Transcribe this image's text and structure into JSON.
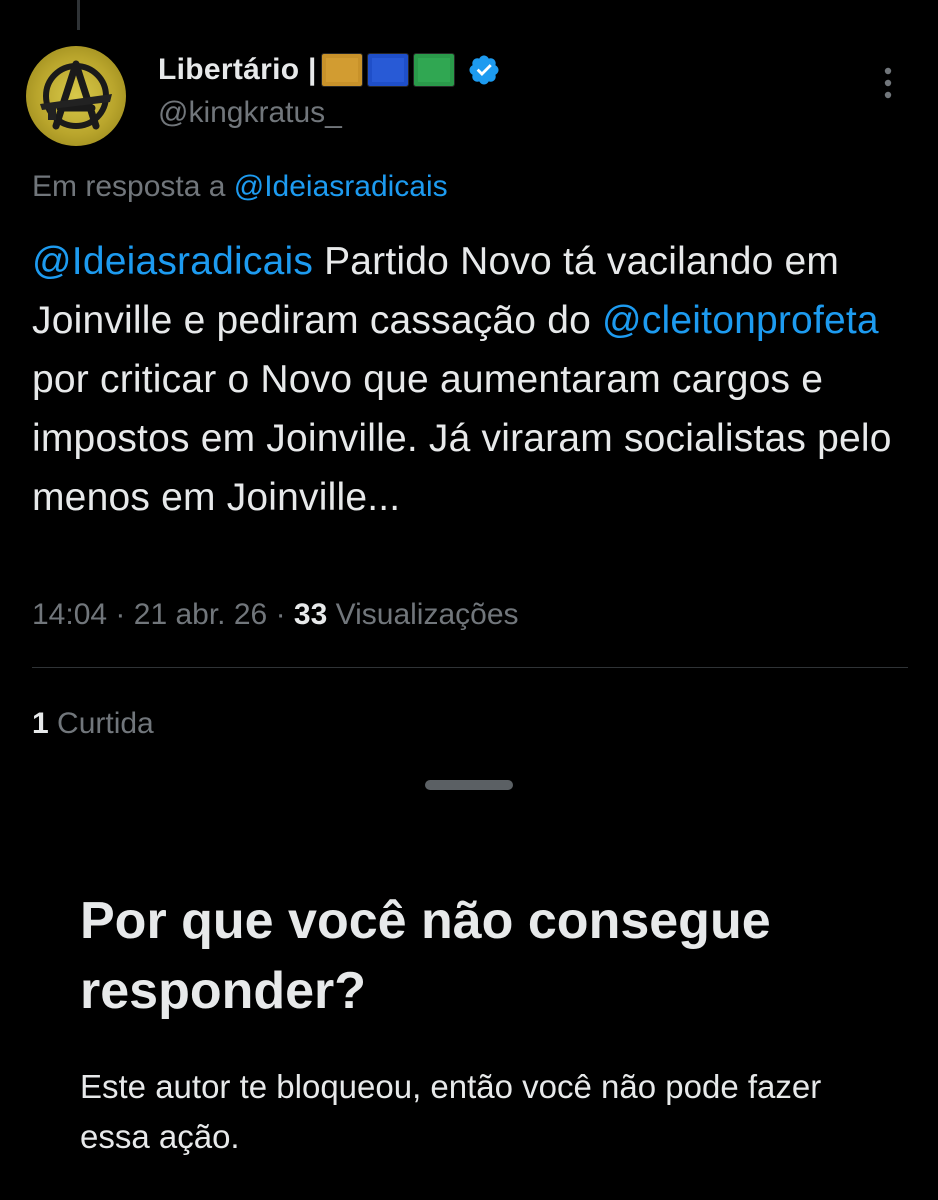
{
  "tweet": {
    "author": {
      "display_name": "Libertário |",
      "handle": "@kingkratus_",
      "verified": true,
      "flag_colors": [
        "#c8922a",
        "#1f4fc9",
        "#2a9a4a"
      ]
    },
    "reply_to_label": "Em resposta a",
    "reply_to_handle": "@Ideiasradicais",
    "text": {
      "mention1": "@Ideiasradicais",
      "part1": " Partido Novo tá vacilando em Joinville e pediram cassação do ",
      "mention2": "@cleitonprofeta",
      "part2": " por criticar o Novo que aumentaram cargos e impostos em Joinville. Já viraram socialistas pelo menos em Joinville..."
    },
    "time": "14:04",
    "date": "21 abr. 26",
    "views_count": "33",
    "views_label": "Visualizações",
    "separator": "·",
    "likes_count": "1",
    "likes_label": "Curtida"
  },
  "sheet": {
    "title": "Por que você não consegue responder?",
    "body": "Este autor te bloqueou, então você não pode fazer essa ação."
  },
  "colors": {
    "background": "#000000",
    "text": "#e7e9ea",
    "muted": "#71767b",
    "link": "#1d9bf0",
    "verified": "#1d9bf0"
  },
  "icons": {
    "more": "more-vertical-icon",
    "verified": "verified-badge-icon"
  }
}
